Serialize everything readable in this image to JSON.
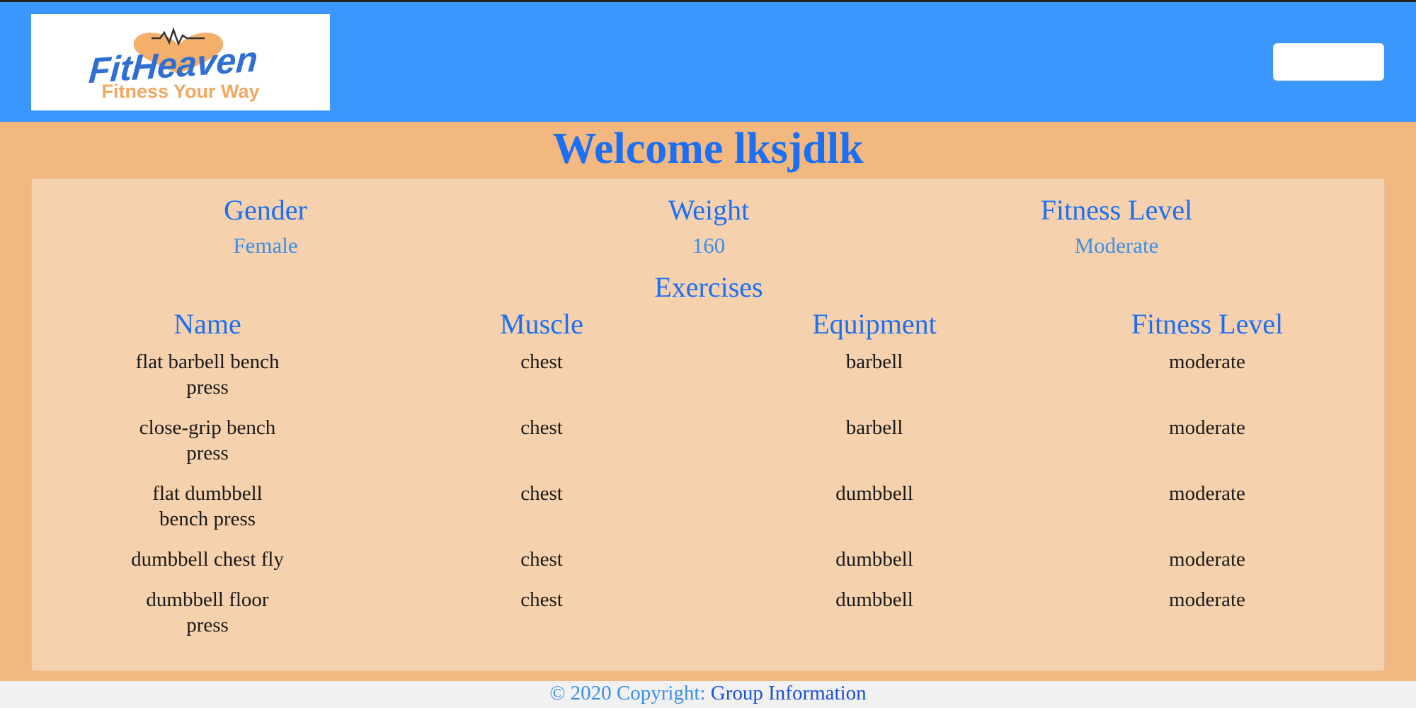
{
  "brand": {
    "name": "FitHeaven",
    "tagline": "Fitness Your Way"
  },
  "welcome": "Welcome lksjdlk",
  "profile": {
    "gender_label": "Gender",
    "gender_value": "Female",
    "weight_label": "Weight",
    "weight_value": "160",
    "fitness_label": "Fitness Level",
    "fitness_value": "Moderate"
  },
  "exercises": {
    "title": "Exercises",
    "headers": [
      "Name",
      "Muscle",
      "Equipment",
      "Fitness Level"
    ],
    "rows": [
      {
        "name_lines": [
          "flat barbell bench",
          "press"
        ],
        "muscle": "chest",
        "equipment": "barbell",
        "level": "moderate"
      },
      {
        "name_lines": [
          "close-grip bench",
          "press"
        ],
        "muscle": "chest",
        "equipment": "barbell",
        "level": "moderate"
      },
      {
        "name_lines": [
          "flat dumbbell",
          "bench press"
        ],
        "muscle": "chest",
        "equipment": "dumbbell",
        "level": "moderate"
      },
      {
        "name_lines": [
          "dumbbell chest fly"
        ],
        "muscle": "chest",
        "equipment": "dumbbell",
        "level": "moderate"
      },
      {
        "name_lines": [
          "dumbbell floor",
          "press"
        ],
        "muscle": "chest",
        "equipment": "dumbbell",
        "level": "moderate"
      }
    ]
  },
  "footer": {
    "copyright": "© 2020 Copyright:",
    "link": "Group Information"
  },
  "colors": {
    "navbar": "#3b96fe",
    "page_bg": "#f2b880",
    "card_bg": "#f5d1ad",
    "accent_blue": "#1b6ff4"
  },
  "icons": {
    "menu_toggle": "hamburger-icon",
    "logo_heart": "heart-icon"
  }
}
